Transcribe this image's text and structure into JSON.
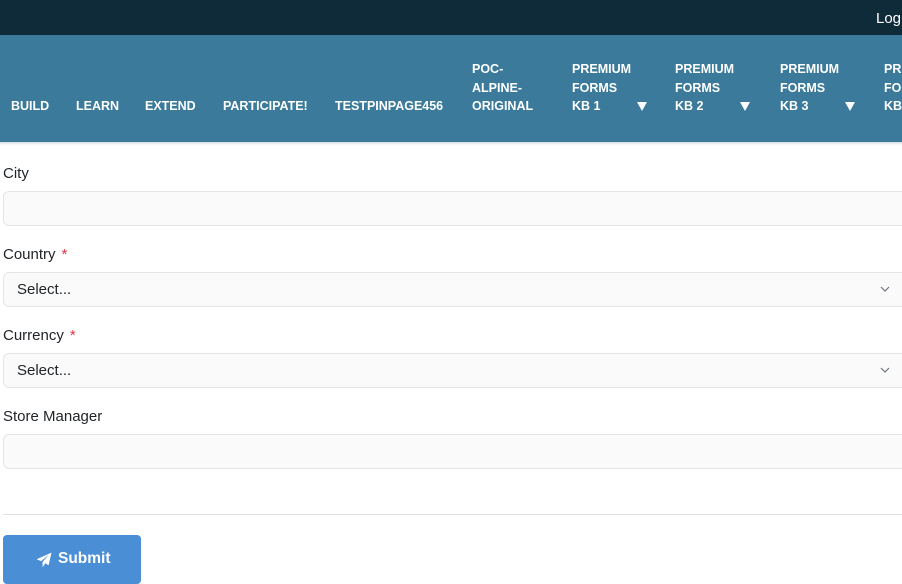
{
  "topbar": {
    "login_label": "Logi"
  },
  "nav": {
    "items": [
      {
        "lines": [
          "BUILD"
        ]
      },
      {
        "lines": [
          "LEARN"
        ]
      },
      {
        "lines": [
          "EXTEND"
        ]
      },
      {
        "lines": [
          "PARTICIPATE!"
        ]
      },
      {
        "lines": [
          "TESTPINPAGE456"
        ]
      },
      {
        "lines": [
          "POC-",
          "ALPINE-",
          "ORIGINAL"
        ]
      },
      {
        "lines": [
          "PREMIUM",
          "FORMS",
          "KB 1"
        ],
        "has_dropdown": true
      },
      {
        "lines": [
          "PREMIUM",
          "FORMS",
          "KB 2"
        ],
        "has_dropdown": true
      },
      {
        "lines": [
          "PREMIUM",
          "FORMS",
          "KB 3"
        ],
        "has_dropdown": true
      },
      {
        "lines": [
          "PRE",
          "FOR",
          "KB"
        ]
      }
    ]
  },
  "form": {
    "city": {
      "label": "City",
      "value": ""
    },
    "country": {
      "label": "Country",
      "required_mark": "*",
      "selected": "Select..."
    },
    "currency": {
      "label": "Currency",
      "required_mark": "*",
      "selected": "Select..."
    },
    "store_manager": {
      "label": "Store Manager",
      "value": ""
    },
    "submit_label": "Submit"
  },
  "colors": {
    "topbar": "#0f2a38",
    "navbar": "#3b7a9b",
    "required": "#dc3545",
    "submit": "#4a8fd6"
  },
  "icons": {
    "dropdown": "caret-down-icon",
    "select": "chevron-down-icon",
    "submit": "paper-plane-icon"
  }
}
